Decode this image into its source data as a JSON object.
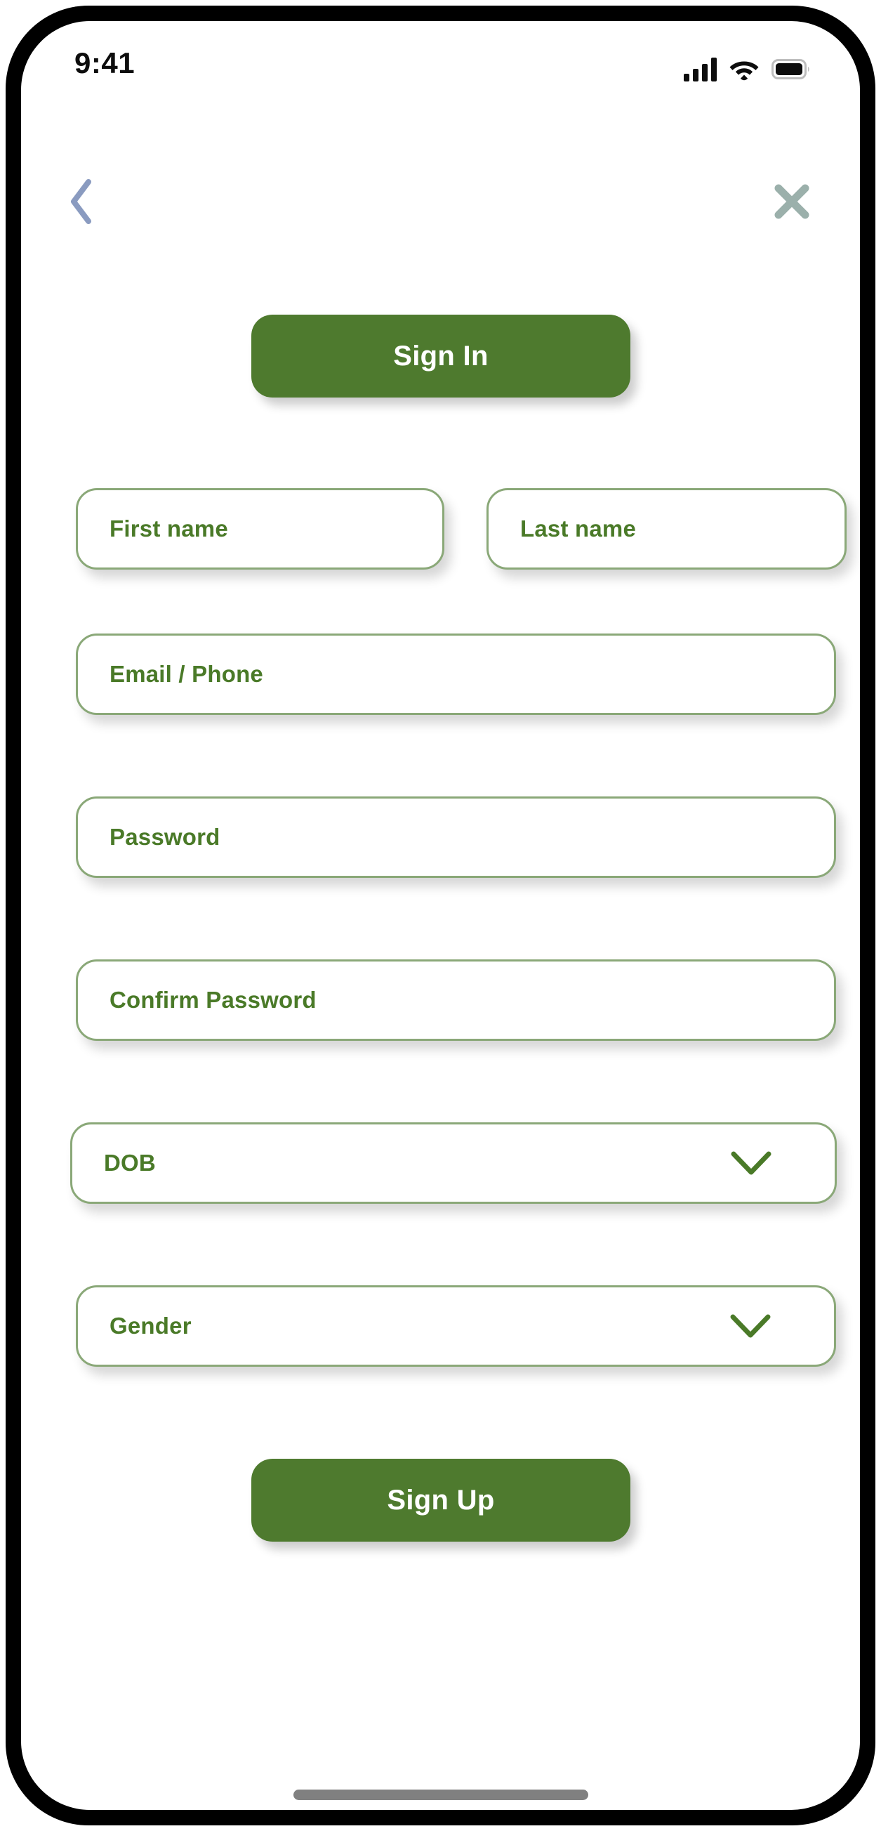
{
  "status_bar": {
    "time": "9:41",
    "cellular_icon": "signal-bars-icon",
    "wifi_icon": "wifi-icon",
    "battery_icon": "battery-full-icon"
  },
  "nav": {
    "back_icon": "chevron-left-icon",
    "back_icon_color": "#8a9bc0",
    "close_icon": "close-x-icon",
    "close_icon_color": "#9bb0ab"
  },
  "theme": {
    "primary_green": "#4e7a2e",
    "field_border_green": "#8aa878",
    "label_green": "#4a7a28",
    "screen_background": "#ffffff",
    "frame_color": "#000000",
    "home_indicator_color": "#808080"
  },
  "form": {
    "sign_in_label": "Sign In",
    "sign_up_label": "Sign Up",
    "fields": [
      {
        "name": "first-name",
        "label": "First name",
        "value": "",
        "placeholder": "First name"
      },
      {
        "name": "last-name",
        "label": "Last name",
        "value": "",
        "placeholder": "Last name"
      },
      {
        "name": "email-phone",
        "label": "Email / Phone",
        "value": "",
        "placeholder": "Email / Phone"
      },
      {
        "name": "password",
        "label": "Password",
        "value": "",
        "placeholder": "Password"
      },
      {
        "name": "confirm-password",
        "label": "Confirm Password",
        "value": "",
        "placeholder": "Confirm Password"
      }
    ],
    "selects": [
      {
        "name": "dob",
        "label": "DOB",
        "chevron_icon": "chevron-down-icon"
      },
      {
        "name": "gender",
        "label": "Gender",
        "chevron_icon": "chevron-down-icon"
      }
    ]
  }
}
